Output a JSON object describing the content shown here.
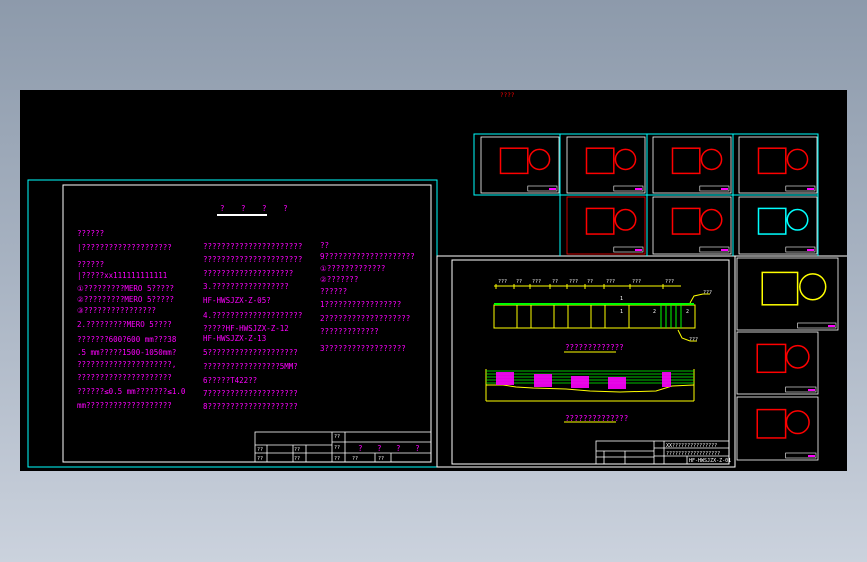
{
  "viewer": {
    "background_color": "#000000",
    "layer_colors": {
      "frame": "#00ffff",
      "border": "#ffffff",
      "text": "#ff00ff",
      "outline": "#ffff00",
      "rebar": "#00ff00",
      "detail": "#ff0000"
    },
    "top_label": "????"
  },
  "notes_sheet": {
    "title": "? ? ? ?",
    "col1": [
      "??????",
      "|????????????????????",
      "??????",
      "|?????xx111111111111",
      "①?????????MERO 5?????",
      "②?????????MERO 5?????",
      "③????????????????",
      "2.?????????MERO 5????",
      "???????600?600 mm???38",
      ".5 mm?????1500-1050mm?",
      "?????????????????????,",
      "?????????????????????",
      "??????≤0.5 mm???????≤1.0",
      "mm???????????????????"
    ],
    "col2": [
      "??????????????????????",
      "??????????????????????",
      "????????????????????",
      "3.?????????????????",
      "HF-HWSJZX-Z-05?",
      "4.????????????????????",
      "?????HF-HWSJZX-Z-12",
      "     HF-HWSJZX-Z-13",
      "5????????????????????",
      "?????????????????5MM?",
      "6?????T422??",
      "7????????????????????",
      "8????????????????????"
    ],
    "col3": [
      "??",
      "9????????????????????",
      "①?????????????",
      "②???????",
      "??????",
      "1?????????????????",
      "2???????????????????",
      "?????????????",
      "3??????????????????"
    ],
    "title_block": {
      "title": "? ? ? ?",
      "cells": [
        "??",
        "??",
        "??",
        "??",
        "??",
        "??",
        "??",
        "??",
        "??",
        "??"
      ]
    }
  },
  "elevation_sheet": {
    "dimension_labels": [
      "???",
      "??",
      "???",
      "??",
      "???",
      "??",
      "???",
      "???",
      "???"
    ],
    "section_marks": [
      "1",
      "1",
      "2",
      "2"
    ],
    "leader_labels": [
      "???",
      "???"
    ],
    "caption_plan": "?????????????",
    "caption_section": "??????????????",
    "side_labels": [
      "?",
      "?",
      "?",
      "?",
      "?"
    ],
    "title_block": {
      "row1": "XX???????????????",
      "row2": "??????????????????",
      "number": "HF-HWSJZX-Z-01",
      "cells": [
        "?",
        "?",
        "?",
        "?",
        "?",
        "?"
      ]
    }
  },
  "thumbnail_sheets": {
    "count": 11
  }
}
